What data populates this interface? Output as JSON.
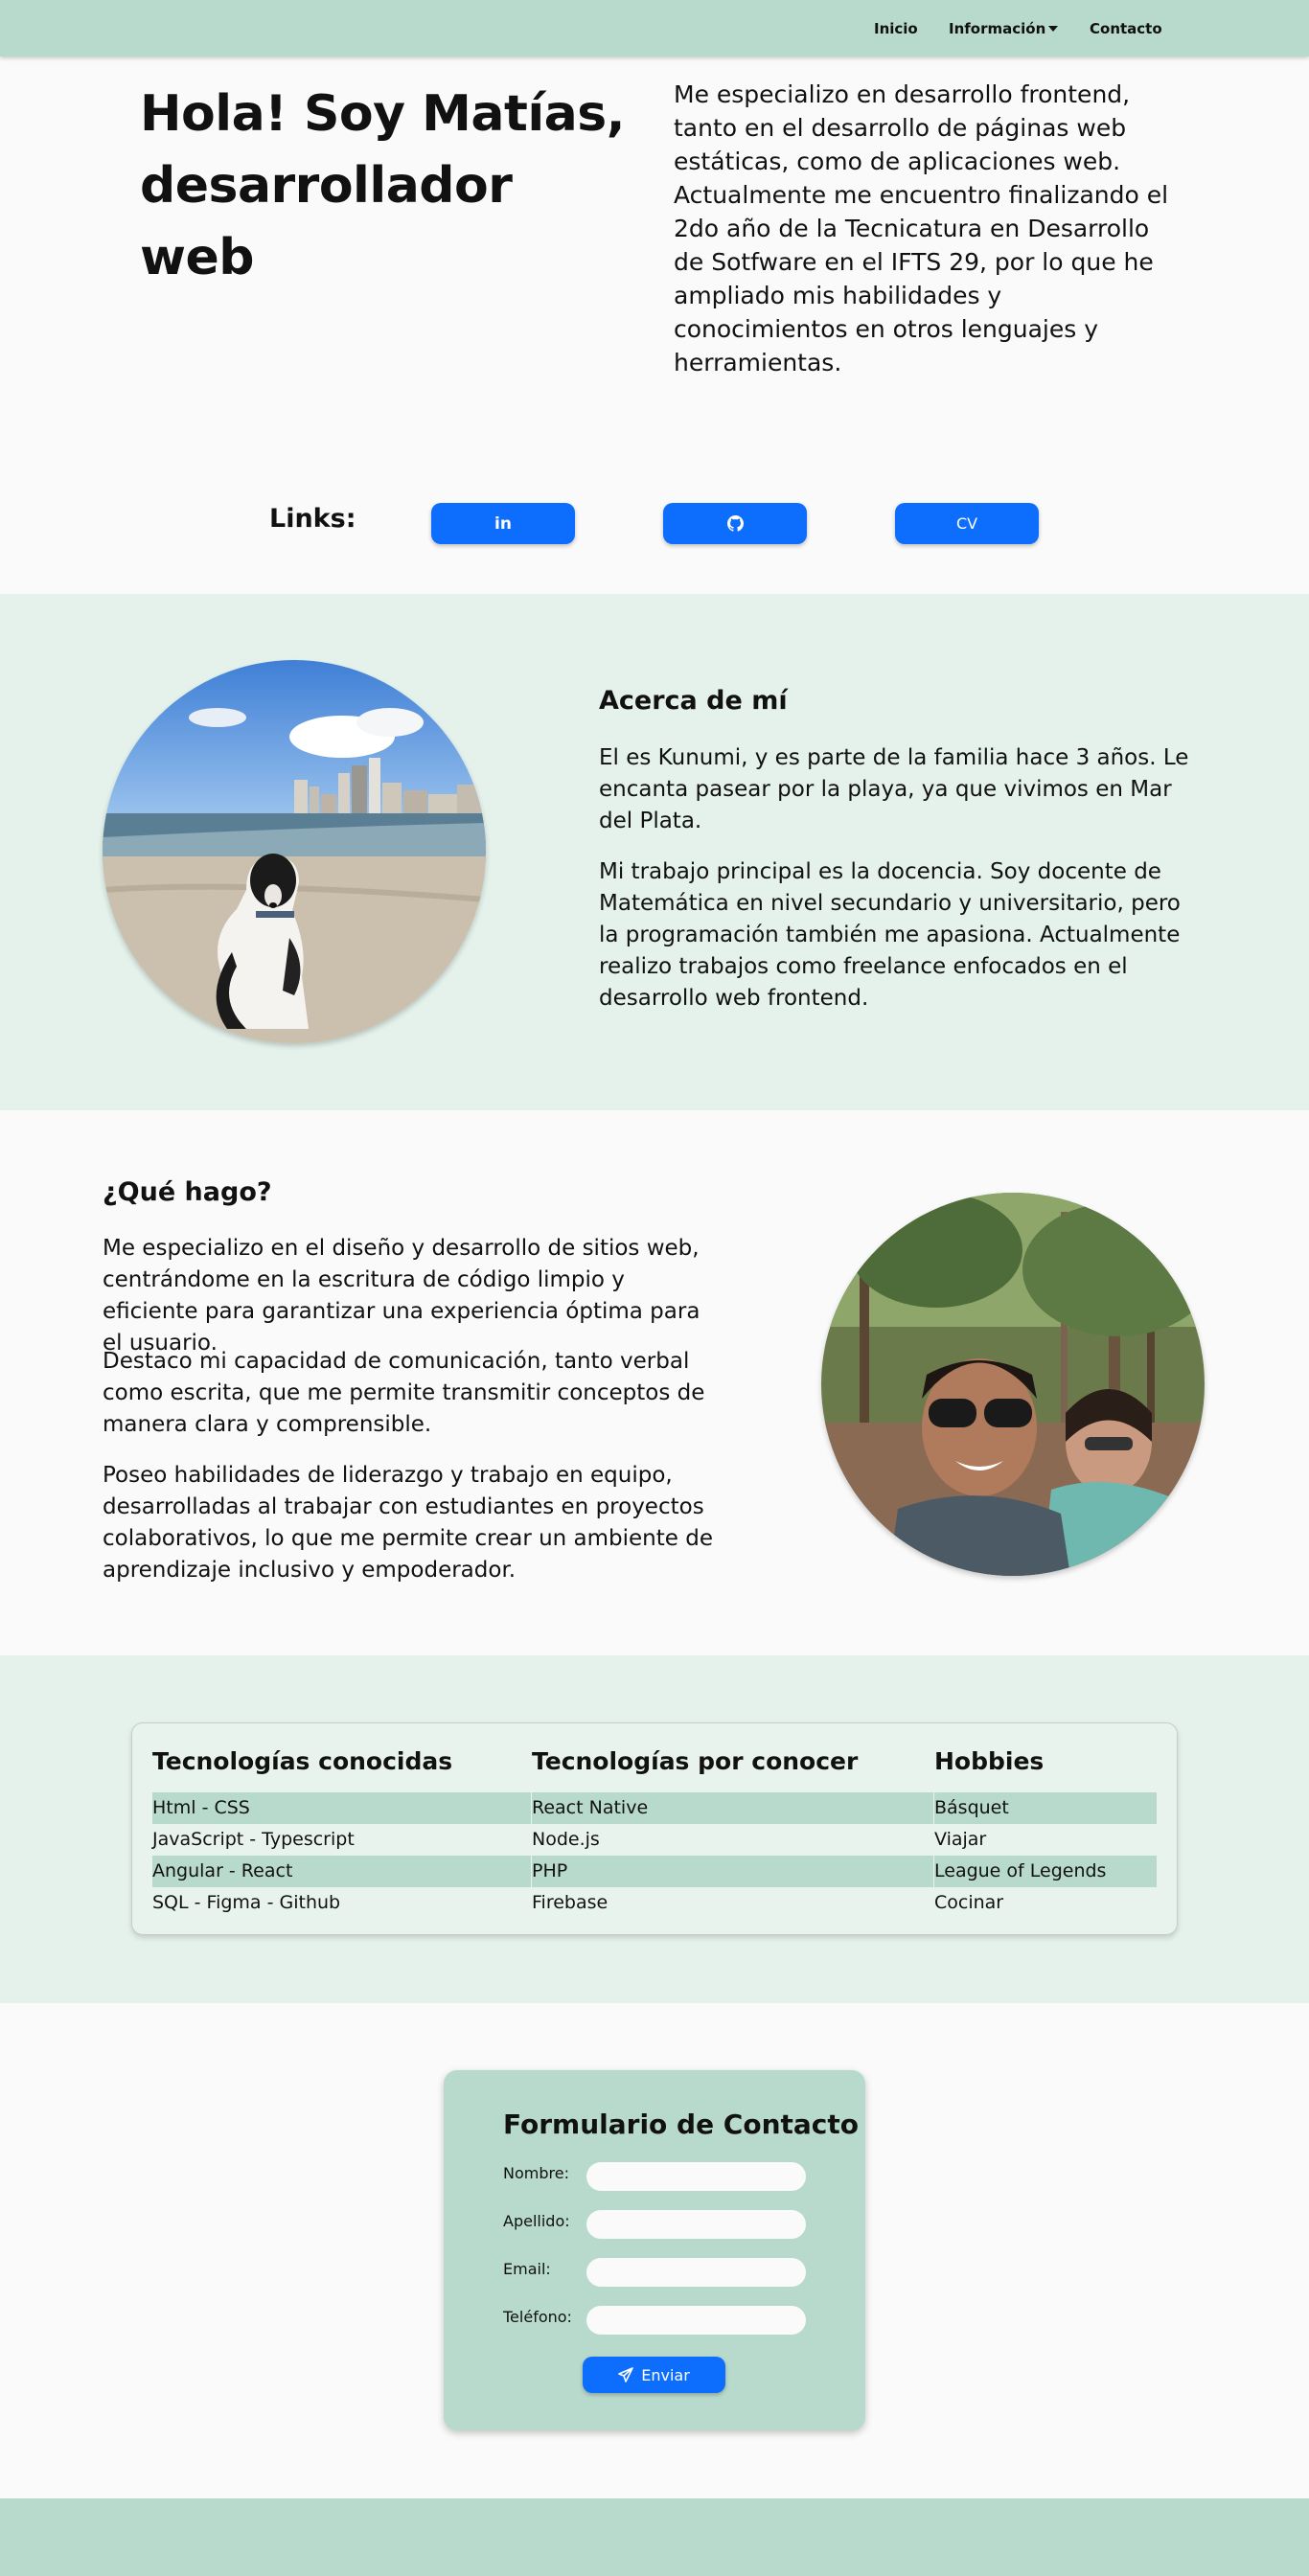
{
  "nav": {
    "items": [
      "Inicio",
      "Información",
      "Contacto"
    ]
  },
  "hero": {
    "title_line1": "Hola! Soy Matías,",
    "title_line2": "desarrollador web",
    "intro": "Me especializo en desarrollo frontend, tanto en el desarrollo de páginas web estáticas, como de aplicaciones web. Actualmente me encuentro finalizando el 2do año de la Tecnicatura en Desarrollo de Sotfware en el IFTS 29, por lo que he ampliado mis habilidades y conocimientos en otros lenguajes y herramientas."
  },
  "links": {
    "label": "Links:",
    "buttons": [
      {
        "label": "in",
        "icon": "linkedin-icon"
      },
      {
        "label": "",
        "icon": "github-icon"
      },
      {
        "label": "CV",
        "icon": ""
      }
    ]
  },
  "about": {
    "title": "Acerca de mí",
    "paragraphs": [
      "El es Kunumi, y es parte de la familia hace 3 años. Le encanta pasear por la playa, ya que vivimos en Mar del Plata.",
      "Mi trabajo principal es la docencia. Soy docente de Matemática en nivel secundario y universitario, pero la programación también me apasiona. Actualmente realizo trabajos como freelance enfocados en el desarrollo web frontend."
    ]
  },
  "what": {
    "title": "¿Qué hago?",
    "paragraphs": [
      "Me especializo en el diseño y desarrollo de sitios web, centrándome en la escritura de código limpio y eficiente para garantizar una experiencia óptima para el usuario.",
      "Destaco mi capacidad de comunicación, tanto verbal como escrita, que me permite transmitir conceptos de manera clara y comprensible.",
      "Poseo habilidades de liderazgo y trabajo en equipo, desarrolladas al trabajar con estudiantes en proyectos colaborativos, lo que me permite crear un ambiente de aprendizaje inclusivo y empoderador."
    ]
  },
  "tech": {
    "columns": [
      {
        "title": "Tecnologías conocidas",
        "items": [
          "Html - CSS",
          "JavaScript - Typescript",
          "Angular - React",
          "SQL - Figma - Github"
        ]
      },
      {
        "title": "Tecnologías por conocer",
        "items": [
          "React Native",
          "Node.js",
          "PHP",
          "Firebase"
        ]
      },
      {
        "title": "Hobbies",
        "items": [
          "Básquet",
          "Viajar",
          "League of Legends",
          "Cocinar"
        ]
      }
    ]
  },
  "contact": {
    "title": "Formulario de Contacto",
    "fields": [
      {
        "label": "Nombre:",
        "value": ""
      },
      {
        "label": "Apellido:",
        "value": ""
      },
      {
        "label": "Email:",
        "value": ""
      },
      {
        "label": "Teléfono:",
        "value": ""
      }
    ],
    "submit_label": "Enviar"
  },
  "colors": {
    "navbar": "#b8dacc",
    "section_alt": "#e5f2ec",
    "accent_button": "#0d6efd",
    "highlight_row": "#b8dacc"
  }
}
